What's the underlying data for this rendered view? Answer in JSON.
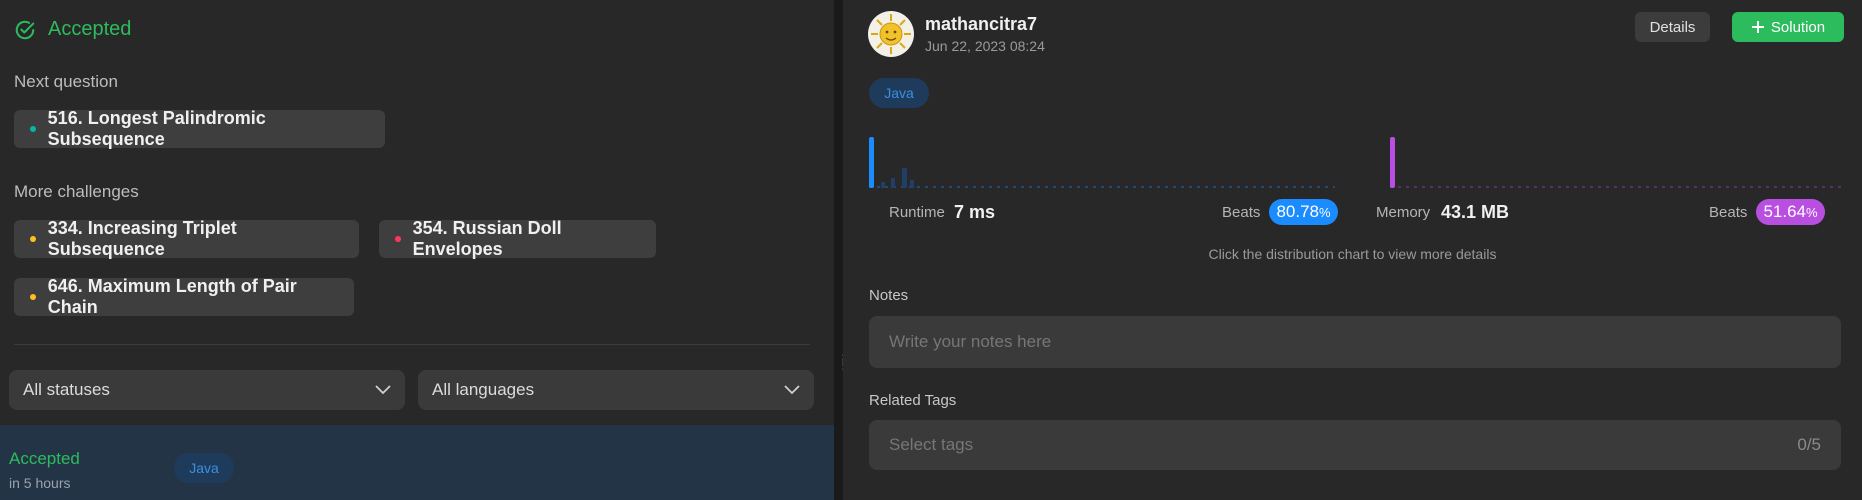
{
  "left": {
    "status": "Accepted",
    "next_question_label": "Next question",
    "next_question": {
      "title": "516. Longest Palindromic Subsequence",
      "dot_color": "#00b8a3"
    },
    "more_challenges_label": "More challenges",
    "challenges": [
      {
        "title": "334. Increasing Triplet Subsequence",
        "dot_color": "#ffc01e"
      },
      {
        "title": "354. Russian Doll Envelopes",
        "dot_color": "#ff375f"
      },
      {
        "title": "646. Maximum Length of Pair Chain",
        "dot_color": "#ffc01e"
      }
    ],
    "filters": {
      "status": "All statuses",
      "language": "All languages"
    },
    "submission": {
      "status": "Accepted",
      "time": "in 5 hours",
      "language": "Java"
    }
  },
  "right": {
    "username": "mathancitra7",
    "datetime": "Jun 22, 2023 08:24",
    "details_label": "Details",
    "solution_label": "Solution",
    "language": "Java",
    "runtime": {
      "label": "Runtime",
      "value": "7 ms",
      "beats_label": "Beats",
      "beats_main": "80.78",
      "beats_unit": "%",
      "color": "#1a8cff"
    },
    "memory": {
      "label": "Memory",
      "value": "43.1 MB",
      "beats_label": "Beats",
      "beats_main": "51.64",
      "beats_unit": "%",
      "color": "#b84fe0"
    },
    "hint": "Click the distribution chart to view more details",
    "notes_label": "Notes",
    "notes_placeholder": "Write your notes here",
    "related_tags_label": "Related Tags",
    "tags_placeholder": "Select tags",
    "tags_count": "0/5"
  }
}
